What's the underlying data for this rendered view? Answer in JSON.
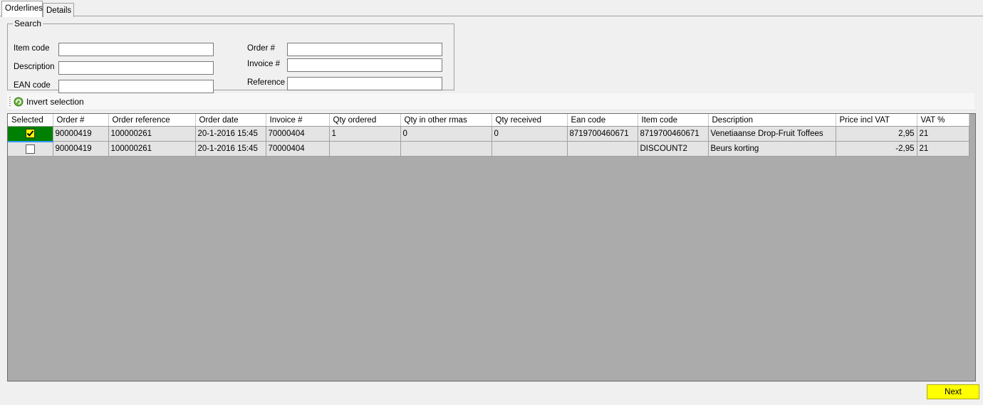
{
  "tabs": [
    {
      "label": "Orderlines",
      "active": true
    },
    {
      "label": "Details",
      "active": false
    }
  ],
  "search": {
    "legend": "Search",
    "item_code_label": "Item code",
    "item_code_value": "",
    "description_label": "Description",
    "description_value": "",
    "ean_code_label": "EAN code",
    "ean_code_value": "",
    "order_label": "Order #",
    "order_value": "",
    "invoice_label": "Invoice #",
    "invoice_value": "",
    "reference_label": "Reference",
    "reference_value": ""
  },
  "toolbar": {
    "invert_label": "Invert selection",
    "invert_icon": "invert-selection-icon"
  },
  "grid": {
    "columns": [
      "Selected",
      "Order #",
      "Order reference",
      "Order date",
      "Invoice #",
      "Qty ordered",
      "Qty in other rmas",
      "Qty received",
      "Ean code",
      "Item code",
      "Description",
      "Price incl VAT",
      "VAT %"
    ],
    "rows": [
      {
        "selected": true,
        "order": "90000419",
        "order_reference": "100000261",
        "order_date": "20-1-2016 15:45",
        "invoice": "70000404",
        "qty_ordered": "1",
        "qty_other_rmas": "0",
        "qty_received": "0",
        "ean_code": "8719700460671",
        "item_code": "8719700460671",
        "description": "Venetiaanse Drop-Fruit Toffees",
        "price_incl_vat": "2,95",
        "vat": "21"
      },
      {
        "selected": false,
        "order": "90000419",
        "order_reference": "100000261",
        "order_date": "20-1-2016 15:45",
        "invoice": "70000404",
        "qty_ordered": "",
        "qty_other_rmas": "",
        "qty_received": "",
        "ean_code": "",
        "item_code": "DISCOUNT2",
        "description": "Beurs korting",
        "price_incl_vat": "-2,95",
        "vat": "21"
      }
    ]
  },
  "next_label": "Next",
  "colors": {
    "selected_cell": "#008000",
    "checked_box": "#ffff00",
    "next_button": "#ffff00",
    "grid_background": "#ababab"
  }
}
